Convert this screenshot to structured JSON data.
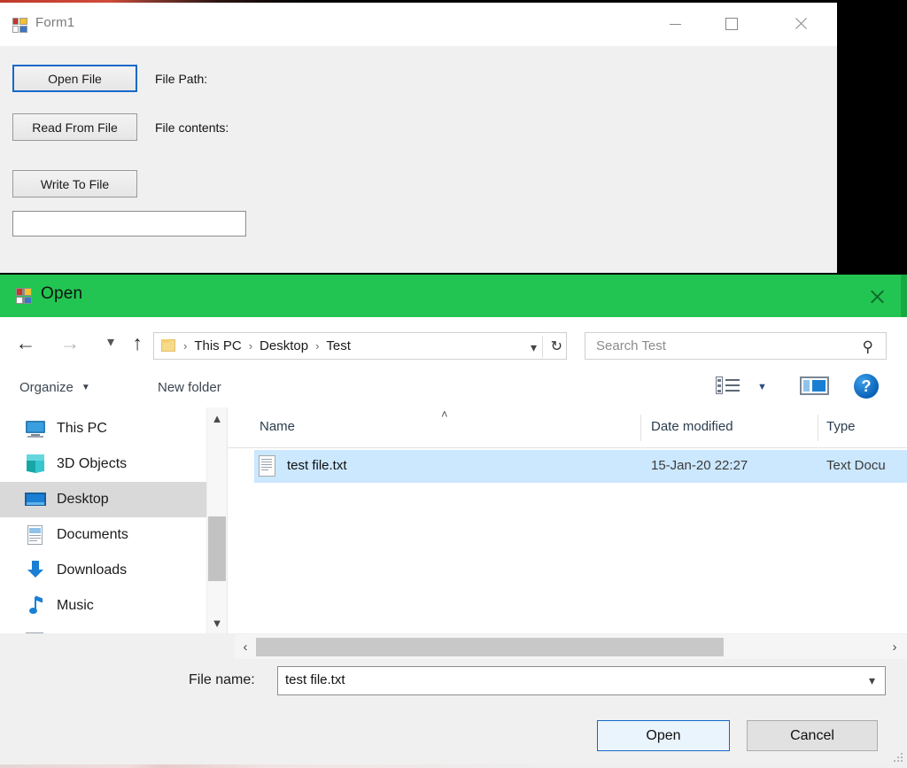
{
  "form_window": {
    "title": "Form1",
    "icon": "vs-form-designer-icon",
    "caption_buttons": {
      "minimize": "minimize-icon",
      "maximize": "maximize-icon",
      "close": "close-icon"
    },
    "buttons": {
      "open_file": "Open File",
      "read_from_file": "Read From File",
      "write_to_file": "Write To File"
    },
    "labels": {
      "file_path": "File Path:",
      "file_contents": "File contents:"
    },
    "textbox_value": ""
  },
  "open_dialog": {
    "title": "Open",
    "icon": "vs-form-designer-icon",
    "titlebar_color": "#22c551",
    "close_icon": "close-icon",
    "nav": {
      "back": "back-arrow-icon",
      "forward": "forward-arrow-icon",
      "recent": "recent-locations-chevron-icon",
      "up": "up-arrow-icon"
    },
    "address": {
      "folder_icon": "folder-icon",
      "crumbs": [
        "This PC",
        "Desktop",
        "Test"
      ],
      "separator": "›",
      "dropdown_icon": "chevron-down-icon",
      "refresh_icon": "refresh-icon"
    },
    "search": {
      "placeholder": "Search Test",
      "icon": "search-icon"
    },
    "toolbar": {
      "organize": "Organize",
      "organize_caret": "▼",
      "new_folder": "New folder",
      "view_mode_icon": "view-mode-icon",
      "view_mode_caret": "▼",
      "preview_pane_icon": "preview-pane-icon",
      "help_icon": "?"
    },
    "sidebar": {
      "items": [
        {
          "label": "This PC",
          "icon": "this-pc-icon",
          "selected": false
        },
        {
          "label": "3D Objects",
          "icon": "3d-objects-icon",
          "selected": false
        },
        {
          "label": "Desktop",
          "icon": "desktop-icon",
          "selected": true
        },
        {
          "label": "Documents",
          "icon": "documents-icon",
          "selected": false
        },
        {
          "label": "Downloads",
          "icon": "downloads-icon",
          "selected": false
        },
        {
          "label": "Music",
          "icon": "music-icon",
          "selected": false
        },
        {
          "label": "",
          "icon": "pictures-icon",
          "selected": false
        }
      ],
      "scrollbar": {
        "up_icon": "chevron-up-icon",
        "down_icon": "chevron-down-icon"
      }
    },
    "file_list": {
      "columns": [
        "Name",
        "Date modified",
        "Type"
      ],
      "sort_column": "Name",
      "sort_icon": "˄",
      "rows": [
        {
          "icon": "text-file-icon",
          "name": "test file.txt",
          "date_modified": "15-Jan-20 22:27",
          "type": "Text Docu",
          "selected": true
        }
      ],
      "h_scrollbar": {
        "left_icon": "‹",
        "right_icon": "›"
      }
    },
    "footer": {
      "file_name_label": "File name:",
      "file_name_value": "test file.txt",
      "file_name_dropdown_icon": "chevron-down-icon",
      "open_button": "Open",
      "cancel_button": "Cancel",
      "resize_grip": "resize-grip-icon"
    }
  }
}
